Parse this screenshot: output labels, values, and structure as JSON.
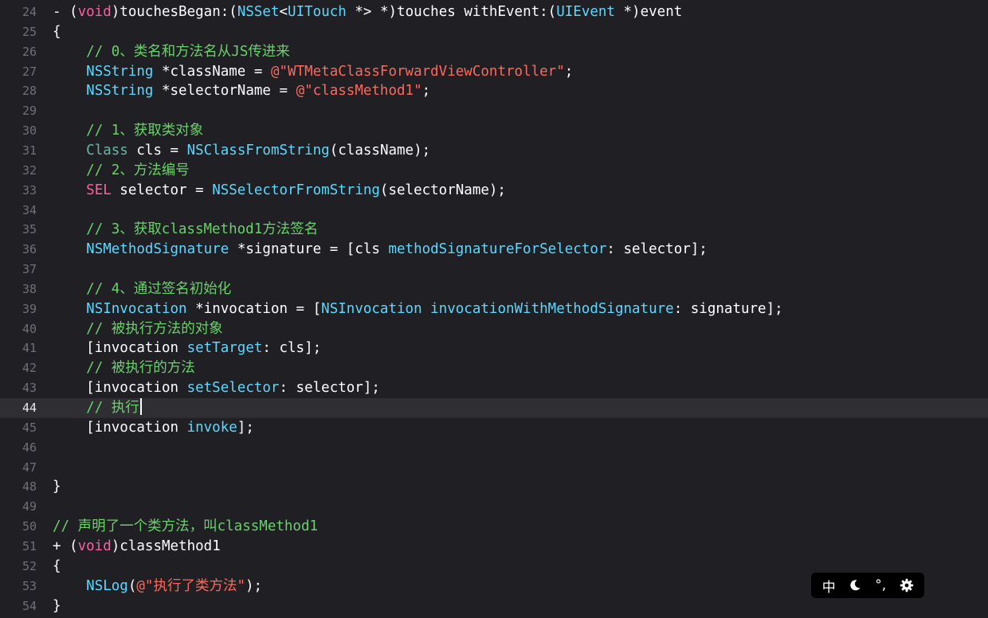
{
  "editor": {
    "current_line": "44",
    "lines": [
      {
        "n": "24",
        "t": [
          [
            "tok-plain",
            "- ("
          ],
          [
            "tok-kw",
            "void"
          ],
          [
            "tok-plain",
            ")touchesBegan:("
          ],
          [
            "tok-type",
            "NSSet"
          ],
          [
            "tok-plain",
            "<"
          ],
          [
            "tok-type",
            "UITouch"
          ],
          [
            "tok-plain",
            " *> *)touches withEvent:("
          ],
          [
            "tok-type",
            "UIEvent"
          ],
          [
            "tok-plain",
            " *)event"
          ]
        ]
      },
      {
        "n": "25",
        "t": [
          [
            "tok-plain",
            "{"
          ]
        ]
      },
      {
        "n": "26",
        "t": [
          [
            "tok-plain",
            "    "
          ],
          [
            "tok-com",
            "// 0、类名和方法名从JS传进来"
          ]
        ]
      },
      {
        "n": "27",
        "t": [
          [
            "tok-plain",
            "    "
          ],
          [
            "tok-type",
            "NSString"
          ],
          [
            "tok-plain",
            " *className = "
          ],
          [
            "tok-str",
            "@\"WTMetaClassForwardViewController\""
          ],
          [
            "tok-plain",
            ";"
          ]
        ]
      },
      {
        "n": "28",
        "t": [
          [
            "tok-plain",
            "    "
          ],
          [
            "tok-type",
            "NSString"
          ],
          [
            "tok-plain",
            " *selectorName = "
          ],
          [
            "tok-str",
            "@\"classMethod1\""
          ],
          [
            "tok-plain",
            ";"
          ]
        ]
      },
      {
        "n": "29",
        "t": []
      },
      {
        "n": "30",
        "t": [
          [
            "tok-plain",
            "    "
          ],
          [
            "tok-com",
            "// 1、获取类对象"
          ]
        ]
      },
      {
        "n": "31",
        "t": [
          [
            "tok-plain",
            "    "
          ],
          [
            "tok-fn",
            "Class"
          ],
          [
            "tok-plain",
            " cls = "
          ],
          [
            "tok-type",
            "NSClassFromString"
          ],
          [
            "tok-plain",
            "(className);"
          ]
        ]
      },
      {
        "n": "32",
        "t": [
          [
            "tok-plain",
            "    "
          ],
          [
            "tok-com",
            "// 2、方法编号"
          ]
        ]
      },
      {
        "n": "33",
        "t": [
          [
            "tok-plain",
            "    "
          ],
          [
            "tok-kw",
            "SEL"
          ],
          [
            "tok-plain",
            " selector = "
          ],
          [
            "tok-type",
            "NSSelectorFromString"
          ],
          [
            "tok-plain",
            "(selectorName);"
          ]
        ]
      },
      {
        "n": "34",
        "t": []
      },
      {
        "n": "35",
        "t": [
          [
            "tok-plain",
            "    "
          ],
          [
            "tok-com",
            "// 3、获取classMethod1方法签名"
          ]
        ]
      },
      {
        "n": "36",
        "t": [
          [
            "tok-plain",
            "    "
          ],
          [
            "tok-type",
            "NSMethodSignature"
          ],
          [
            "tok-plain",
            " *signature = [cls "
          ],
          [
            "tok-type",
            "methodSignatureForSelector"
          ],
          [
            "tok-plain",
            ": selector];"
          ]
        ]
      },
      {
        "n": "37",
        "t": []
      },
      {
        "n": "38",
        "t": [
          [
            "tok-plain",
            "    "
          ],
          [
            "tok-com",
            "// 4、通过签名初始化"
          ]
        ]
      },
      {
        "n": "39",
        "t": [
          [
            "tok-plain",
            "    "
          ],
          [
            "tok-type",
            "NSInvocation"
          ],
          [
            "tok-plain",
            " *invocation = ["
          ],
          [
            "tok-type",
            "NSInvocation"
          ],
          [
            "tok-plain",
            " "
          ],
          [
            "tok-type",
            "invocationWithMethodSignature"
          ],
          [
            "tok-plain",
            ": signature];"
          ]
        ]
      },
      {
        "n": "40",
        "t": [
          [
            "tok-plain",
            "    "
          ],
          [
            "tok-com",
            "// 被执行方法的对象"
          ]
        ]
      },
      {
        "n": "41",
        "t": [
          [
            "tok-plain",
            "    [invocation "
          ],
          [
            "tok-type",
            "setTarget"
          ],
          [
            "tok-plain",
            ": cls];"
          ]
        ]
      },
      {
        "n": "42",
        "t": [
          [
            "tok-plain",
            "    "
          ],
          [
            "tok-com",
            "// 被执行的方法"
          ]
        ]
      },
      {
        "n": "43",
        "t": [
          [
            "tok-plain",
            "    [invocation "
          ],
          [
            "tok-type",
            "setSelector"
          ],
          [
            "tok-plain",
            ": selector];"
          ]
        ]
      },
      {
        "n": "44",
        "t": [
          [
            "tok-plain",
            "    "
          ],
          [
            "tok-com",
            "// 执行"
          ]
        ]
      },
      {
        "n": "45",
        "t": [
          [
            "tok-plain",
            "    [invocation "
          ],
          [
            "tok-type",
            "invoke"
          ],
          [
            "tok-plain",
            "];"
          ]
        ]
      },
      {
        "n": "46",
        "t": []
      },
      {
        "n": "47",
        "t": []
      },
      {
        "n": "48",
        "t": [
          [
            "tok-plain",
            "}"
          ]
        ]
      },
      {
        "n": "49",
        "t": []
      },
      {
        "n": "50",
        "t": [
          [
            "tok-com",
            "// 声明了一个类方法，叫classMethod1"
          ]
        ]
      },
      {
        "n": "51",
        "t": [
          [
            "tok-plain",
            "+ ("
          ],
          [
            "tok-kw",
            "void"
          ],
          [
            "tok-plain",
            ")classMethod1"
          ]
        ]
      },
      {
        "n": "52",
        "t": [
          [
            "tok-plain",
            "{"
          ]
        ]
      },
      {
        "n": "53",
        "t": [
          [
            "tok-plain",
            "    "
          ],
          [
            "tok-type",
            "NSLog"
          ],
          [
            "tok-plain",
            "("
          ],
          [
            "tok-str",
            "@\"执行了类方法\""
          ],
          [
            "tok-plain",
            ");"
          ]
        ]
      },
      {
        "n": "54",
        "t": [
          [
            "tok-plain",
            "}"
          ]
        ]
      }
    ]
  },
  "ime_toolbar": {
    "lang_label": "中",
    "moon_icon": "moon-icon",
    "punct_label": "°,",
    "gear_icon": "gear-icon"
  },
  "colors": {
    "background": "#1f1f24",
    "current_line": "#2e2e33",
    "keyword": "#fc5fa3",
    "type": "#5dd8ff",
    "string": "#fc6a5d",
    "comment": "#6bd16b"
  }
}
